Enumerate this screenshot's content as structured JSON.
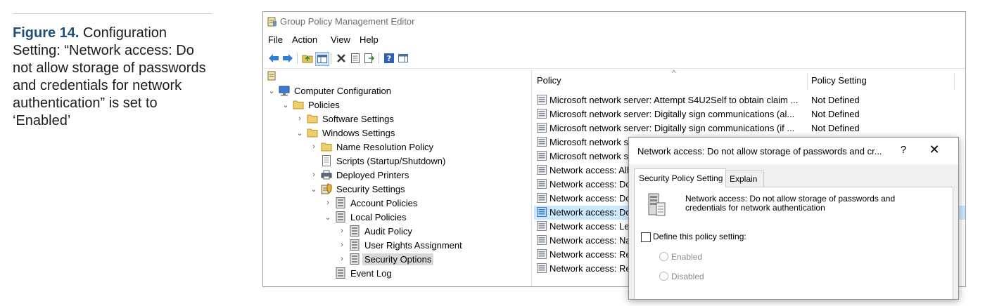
{
  "caption": {
    "figure_label": "Figure 14.",
    "text": " Configuration Setting: “Network access: Do not allow storage of passwords and credentials for network authentication” is set to ‘Enabled’"
  },
  "window": {
    "title": "Group Policy Management Editor",
    "menu": [
      "File",
      "Action",
      "View",
      "Help"
    ]
  },
  "tree": {
    "items": [
      {
        "label": "Computer Configuration",
        "icon": "computer-icon",
        "expand": "expanded"
      },
      {
        "label": "Policies",
        "icon": "folder-icon",
        "expand": "expanded"
      },
      {
        "label": "Software Settings",
        "icon": "folder-icon",
        "expand": "collapsed"
      },
      {
        "label": "Windows Settings",
        "icon": "folder-icon",
        "expand": "expanded"
      },
      {
        "label": "Name Resolution Policy",
        "icon": "folder-icon",
        "expand": "collapsed"
      },
      {
        "label": "Scripts (Startup/Shutdown)",
        "icon": "script-icon",
        "expand": "none"
      },
      {
        "label": "Deployed Printers",
        "icon": "printer-icon",
        "expand": "collapsed"
      },
      {
        "label": "Security Settings",
        "icon": "security-settings-icon",
        "expand": "expanded"
      },
      {
        "label": "Account Policies",
        "icon": "policy-icon",
        "expand": "collapsed"
      },
      {
        "label": "Local Policies",
        "icon": "policy-icon",
        "expand": "expanded"
      },
      {
        "label": "Audit Policy",
        "icon": "policy-icon",
        "expand": "collapsed"
      },
      {
        "label": "User Rights Assignment",
        "icon": "policy-icon",
        "expand": "collapsed"
      },
      {
        "label": "Security Options",
        "icon": "policy-icon",
        "expand": "collapsed",
        "selected": true
      },
      {
        "label": "Event Log",
        "icon": "policy-icon",
        "expand": "none"
      }
    ]
  },
  "list": {
    "columns": [
      "Policy",
      "Policy Setting"
    ],
    "rows": [
      {
        "policy": "Microsoft network server: Attempt S4U2Self to obtain claim ...",
        "setting": "Not Defined"
      },
      {
        "policy": "Microsoft network server: Digitally sign communications (al...",
        "setting": "Not Defined"
      },
      {
        "policy": "Microsoft network server: Digitally sign communications (if ...",
        "setting": "Not Defined"
      },
      {
        "policy": "Microsoft network s",
        "setting": ""
      },
      {
        "policy": "Microsoft network s",
        "setting": ""
      },
      {
        "policy": "Network access: All",
        "setting": ""
      },
      {
        "policy": "Network access: Do",
        "setting": ""
      },
      {
        "policy": "Network access: Do",
        "setting": ""
      },
      {
        "policy": "Network access: Do",
        "setting": "",
        "selected": true
      },
      {
        "policy": "Network access: Let",
        "setting": ""
      },
      {
        "policy": "Network access: Na",
        "setting": ""
      },
      {
        "policy": "Network access: Re",
        "setting": ""
      },
      {
        "policy": "Network access: Re",
        "setting": ""
      }
    ]
  },
  "dialog": {
    "title": "Network access: Do not allow storage of passwords and cr...",
    "help": "?",
    "close": "✕",
    "tabs": [
      "Security Policy Setting",
      "Explain"
    ],
    "active_tab": "Security Policy Setting",
    "description_line1": "Network access: Do not allow storage of passwords and",
    "description_line2": "credentials for network authentication",
    "define_label": "Define this policy setting:",
    "define_checked": false,
    "options": [
      "Enabled",
      "Disabled"
    ]
  },
  "colors": {
    "caption_accent": "#1f4e79",
    "selection": "#d9d9d9",
    "list_selection": "#cce8ff"
  }
}
